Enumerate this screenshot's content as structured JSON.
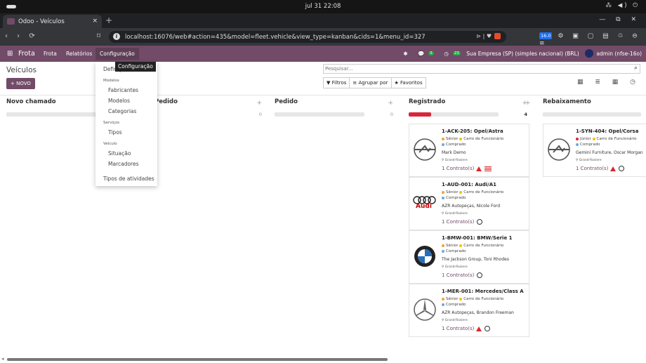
{
  "os": {
    "clock": "jul 31  22:08",
    "tray": "⁂ ◀) ⏻"
  },
  "browser": {
    "tab_title": "Odoo - Veículos",
    "tab_close": "×",
    "new_tab": "+",
    "win_controls": "—  ⧉  ✕",
    "nav": "‹ › ⟳",
    "bookmark": "⌑",
    "url": "localhost:16076/web#action=435&model=fleet.vehicle&view_type=kanban&cids=1&menu_id=327",
    "omni_right": "⊳ | ♥",
    "ext_version": "16.0",
    "ext_rest": "⚙ ▣  ▢ ▤ ♲ ⊖ ≡"
  },
  "nav": {
    "apps_icon": "⊞",
    "brand": "Frota",
    "menu1": "Frota",
    "menu2": "Relatórios",
    "menu3": "Configuração",
    "bug": "✱",
    "chat": "💬",
    "chat_badge": "5",
    "activity": "◷",
    "activity_badge": "23",
    "company": "Sua Empresa (SP) (simples nacional) (BRL)",
    "user": "admin (nfse-16o)"
  },
  "control": {
    "title": "Veículos",
    "new_button": "+ NOVO",
    "search_placeholder": "Pesquisar...",
    "search_icon": "⌕",
    "filters": "▼ Filtros",
    "groupby": "≡ Agrupar por",
    "favorites": "★ Favoritos",
    "views": "▦ ≣ ▦ ◷"
  },
  "tooltip": "Configuração",
  "dropdown": {
    "definicoes": "Definições",
    "modelos_header": "Modelos",
    "fabricantes": "Fabricantes",
    "modelos": "Modelos",
    "categorias": "Categorias",
    "servicos_header": "Serviços",
    "tipos": "Tipos",
    "veiculo_header": "Veículo",
    "situacao": "Situação",
    "marcadores": "Marcadores",
    "tipos_atividades": "Tipos de atividades"
  },
  "columns": [
    {
      "title": "Novo chamado",
      "plus": "",
      "count": ""
    },
    {
      "title": "Pedido",
      "plus": "+",
      "count": "0"
    },
    {
      "title": "Pedido",
      "plus": "+",
      "count": "0"
    },
    {
      "title": "Registrado",
      "plus": "+",
      "count": "4"
    },
    {
      "title": "Rebaixamento",
      "plus": "+",
      "count": ""
    }
  ],
  "cards": [
    {
      "name": "1-ACK-205: Opel/Astra",
      "tag1": "Sênior",
      "tag2": "Carro de Funcionário",
      "tag3": "Comprado",
      "driver": "Mark Demo",
      "location": "⚲ Grand-Rosiere",
      "contracts": "1 Contrato(s)",
      "logo": "opel-logo"
    },
    {
      "name": "1-AUD-001: Audi/A1",
      "tag1": "Sênior",
      "tag2": "Carro de Funcionário",
      "tag3": "Comprado",
      "driver": "AZR Autopeças, Nicole Ford",
      "location": "⚲ Grand-Rosiere",
      "contracts": "1 Contrato(s)",
      "logo": "audi-logo",
      "audi_text": "Audi"
    },
    {
      "name": "1-BMW-001: BMW/Serie 1",
      "tag1": "Sênior",
      "tag2": "Carro de Funcionário",
      "tag3": "Comprado",
      "driver": "The Jackson Group, Toni Rhodes",
      "location": "⚲ Grand-Rosiere",
      "contracts": "1 Contrato(s)",
      "logo": "bmw-logo"
    },
    {
      "name": "1-MER-001: Mercedes/Class A",
      "tag1": "Sênior",
      "tag2": "Carro de Funcionário",
      "tag3": "Comprado",
      "driver": "AZR Autopeças, Brandon Freeman",
      "location": "⚲ Grand-Rosiere",
      "contracts": "1 Contrato(s)",
      "logo": "mercedes-logo"
    },
    {
      "name": "1-SYN-404: Opel/Corsa",
      "tag1": "Júnior",
      "tag2": "Carro de Funcionário",
      "tag3": "Comprado",
      "driver": "Gemini Furniture, Oscar Morgan",
      "location": "⚲ Grand-Rosiere",
      "contracts": "1 Contrato(s)",
      "logo": "opel-logo"
    }
  ],
  "colors": {
    "brand": "#714b67",
    "tag_senior": "#f0a33a",
    "tag_junior": "#d9262b",
    "tag_emp": "#f3c200",
    "tag_bought": "#6fa8dc",
    "progress": "#d9263b"
  }
}
